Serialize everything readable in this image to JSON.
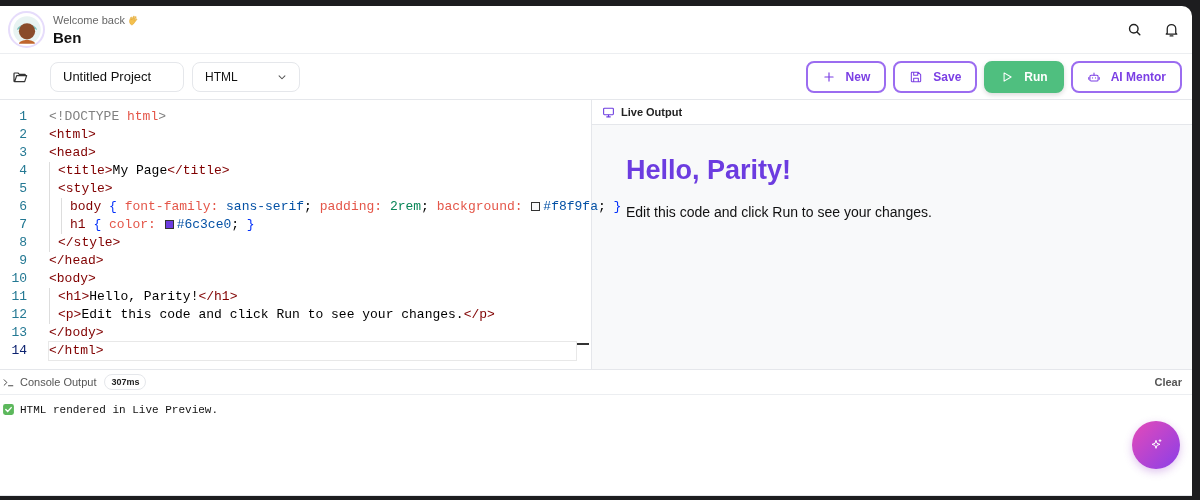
{
  "header": {
    "greeting": "Welcome back",
    "user_name": "Ben"
  },
  "toolbar": {
    "project_name": "Untitled Project",
    "language": "HTML",
    "buttons": [
      {
        "label": "New",
        "kind": "outline"
      },
      {
        "label": "Save",
        "kind": "outline"
      },
      {
        "label": "Run",
        "kind": "filled"
      },
      {
        "label": "AI Mentor",
        "kind": "outline"
      }
    ]
  },
  "editor": {
    "lines": [
      {
        "number": "1",
        "selected": false,
        "tokens": [
          {
            "kind": "meta",
            "text": "<!DOCTYPE "
          },
          {
            "kind": "keyword",
            "text": "html"
          },
          {
            "kind": "meta",
            "text": ">"
          }
        ]
      },
      {
        "number": "2",
        "selected": false,
        "tokens": [
          {
            "kind": "tag",
            "text": "<html>"
          }
        ]
      },
      {
        "number": "3",
        "selected": false,
        "tokens": [
          {
            "kind": "tag",
            "text": "<head>"
          }
        ]
      },
      {
        "number": "4",
        "selected": false,
        "tokens": [
          {
            "kind": "tag",
            "text": "<title>"
          },
          {
            "kind": "text",
            "text": "My Page"
          },
          {
            "kind": "tag",
            "text": "</title>"
          }
        ]
      },
      {
        "number": "5",
        "selected": false,
        "tokens": [
          {
            "kind": "tag",
            "text": "<style>"
          }
        ]
      },
      {
        "number": "6",
        "selected": false,
        "tokens": [
          {
            "kind": "tag",
            "text": "body "
          },
          {
            "kind": "brace",
            "text": "{ "
          },
          {
            "kind": "keyword",
            "text": "font-family: "
          },
          {
            "kind": "value",
            "text": "sans-serif"
          },
          {
            "kind": "text",
            "text": "; "
          },
          {
            "kind": "keyword",
            "text": "padding: "
          },
          {
            "kind": "number",
            "text": "2rem"
          },
          {
            "kind": "text",
            "text": "; "
          },
          {
            "kind": "keyword",
            "text": "background: "
          },
          {
            "kind": "swatch",
            "color": "#f8f9fa"
          },
          {
            "kind": "value",
            "text": "#f8f9fa"
          },
          {
            "kind": "text",
            "text": "; "
          },
          {
            "kind": "brace",
            "text": "}"
          }
        ]
      },
      {
        "number": "7",
        "selected": false,
        "tokens": [
          {
            "kind": "tag",
            "text": "h1 "
          },
          {
            "kind": "brace",
            "text": "{ "
          },
          {
            "kind": "keyword",
            "text": "color: "
          },
          {
            "kind": "swatch",
            "color": "#6c3ce0"
          },
          {
            "kind": "value",
            "text": "#6c3ce0"
          },
          {
            "kind": "text",
            "text": "; "
          },
          {
            "kind": "brace",
            "text": "}"
          }
        ]
      },
      {
        "number": "8",
        "selected": false,
        "tokens": [
          {
            "kind": "tag",
            "text": "</style>"
          }
        ]
      },
      {
        "number": "9",
        "selected": false,
        "tokens": [
          {
            "kind": "tag",
            "text": "</head>"
          }
        ]
      },
      {
        "number": "10",
        "selected": false,
        "tokens": [
          {
            "kind": "tag",
            "text": "<body>"
          }
        ]
      },
      {
        "number": "11",
        "selected": false,
        "tokens": [
          {
            "kind": "tag",
            "text": "<h1>"
          },
          {
            "kind": "text",
            "text": "Hello, Parity!"
          },
          {
            "kind": "tag",
            "text": "</h1>"
          }
        ]
      },
      {
        "number": "12",
        "selected": false,
        "tokens": [
          {
            "kind": "tag",
            "text": "<p>"
          },
          {
            "kind": "text",
            "text": "Edit this code and click Run to see your changes."
          },
          {
            "kind": "tag",
            "text": "</p>"
          }
        ]
      },
      {
        "number": "13",
        "selected": false,
        "tokens": [
          {
            "kind": "tag",
            "text": "</body>"
          }
        ]
      },
      {
        "number": "14",
        "selected": true,
        "tokens": [
          {
            "kind": "tag",
            "text": "</html>"
          }
        ]
      }
    ]
  },
  "live_output": {
    "title": "Live Output",
    "heading": "Hello, Parity!",
    "paragraph": "Edit this code and click Run to see your changes."
  },
  "console": {
    "title": "Console Output",
    "duration": "307ms",
    "clear_label": "Clear",
    "messages": [
      {
        "text": "HTML rendered in Live Preview."
      }
    ]
  }
}
